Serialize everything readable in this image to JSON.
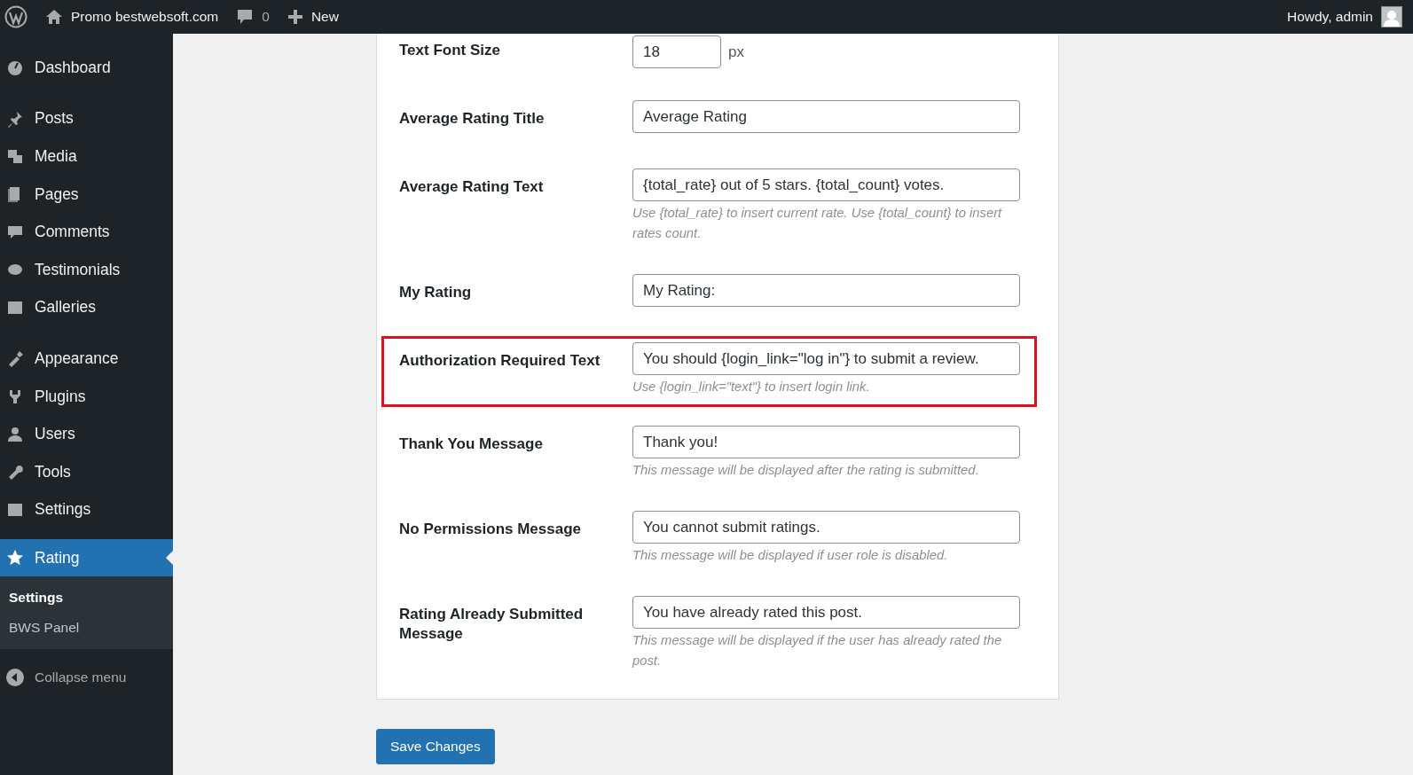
{
  "admin_bar": {
    "site": "Promo bestwebsoft.com",
    "comments": "0",
    "new": "New",
    "greeting": "Howdy, admin"
  },
  "sidebar": {
    "groups": [
      [
        {
          "label": "Dashboard",
          "selected": false
        }
      ],
      [
        {
          "label": "Posts",
          "selected": false
        },
        {
          "label": "Media",
          "selected": false
        },
        {
          "label": "Pages",
          "selected": false
        },
        {
          "label": "Comments",
          "selected": false
        },
        {
          "label": "Testimonials",
          "selected": false
        },
        {
          "label": "Galleries",
          "selected": false
        }
      ],
      [
        {
          "label": "Appearance",
          "selected": false
        },
        {
          "label": "Plugins",
          "selected": false
        },
        {
          "label": "Users",
          "selected": false
        },
        {
          "label": "Tools",
          "selected": false
        },
        {
          "label": "Settings",
          "selected": false
        },
        {
          "label": "Rating",
          "selected": true,
          "children": [
            {
              "label": "Settings",
              "selected": true
            },
            {
              "label": "BWS Panel",
              "selected": false
            }
          ]
        }
      ]
    ],
    "collapse": "Collapse menu"
  },
  "settings": {
    "rows": [
      {
        "label": "Text Font Size",
        "kind": "number",
        "value": "18",
        "unit": "px",
        "highlighted": false
      },
      {
        "label": "Average Rating Title",
        "kind": "text",
        "value": "Average Rating",
        "highlighted": false
      },
      {
        "label": "Average Rating Text",
        "kind": "text",
        "value": "{total_rate} out of 5 stars. {total_count} votes.",
        "description": "Use {total_rate} to insert current rate. Use {total_count} to insert rates count.",
        "highlighted": false
      },
      {
        "label": "My Rating",
        "kind": "text",
        "value": "My Rating:",
        "highlighted": false
      },
      {
        "label": "Authorization Required Text",
        "kind": "text",
        "value": "You should {login_link=\"log in\"} to submit a review.",
        "description": "Use {login_link=\"text\"} to insert login link.",
        "highlighted": true
      },
      {
        "label": "Thank You Message",
        "kind": "text",
        "value": "Thank you!",
        "description": "This message will be displayed after the rating is submitted.",
        "highlighted": false
      },
      {
        "label": "No Permissions Message",
        "kind": "text",
        "value": "You cannot submit ratings.",
        "description": "This message will be displayed if user role is disabled.",
        "highlighted": false
      },
      {
        "label": "Rating Already Submitted Message",
        "kind": "text",
        "value": "You have already rated this post.",
        "description": "This message will be displayed if the user has already rated the post.",
        "highlighted": false
      }
    ],
    "save_button": "Save Changes"
  }
}
